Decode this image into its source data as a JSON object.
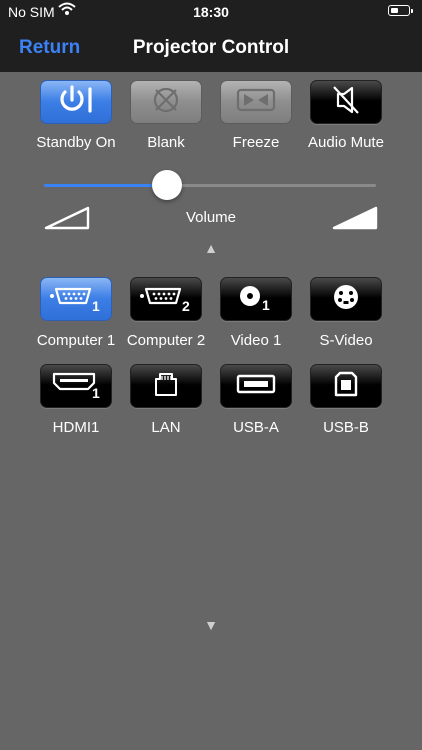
{
  "status": {
    "carrier": "No SIM",
    "time": "18:30"
  },
  "nav": {
    "back_label": "Return",
    "title": "Projector Control"
  },
  "controls": [
    {
      "label": "Standby On",
      "icon": "power-icon",
      "state": "active"
    },
    {
      "label": "Blank",
      "icon": "blank-icon",
      "state": "disabled"
    },
    {
      "label": "Freeze",
      "icon": "freeze-icon",
      "state": "disabled"
    },
    {
      "label": "Audio Mute",
      "icon": "audio-mute-icon",
      "state": "normal"
    }
  ],
  "volume": {
    "label": "Volume",
    "level": 0.37
  },
  "sources": [
    {
      "label": "Computer 1",
      "icon": "vga-1-icon",
      "state": "active"
    },
    {
      "label": "Computer 2",
      "icon": "vga-2-icon",
      "state": "normal"
    },
    {
      "label": "Video 1",
      "icon": "video-1-icon",
      "state": "normal"
    },
    {
      "label": "S-Video",
      "icon": "svideo-icon",
      "state": "normal"
    },
    {
      "label": "HDMI1",
      "icon": "hdmi-icon",
      "state": "normal"
    },
    {
      "label": "LAN",
      "icon": "lan-icon",
      "state": "normal"
    },
    {
      "label": "USB-A",
      "icon": "usb-a-icon",
      "state": "normal"
    },
    {
      "label": "USB-B",
      "icon": "usb-b-icon",
      "state": "normal"
    }
  ],
  "colors": {
    "accent": "#3b82f6",
    "background": "#666666",
    "navbar": "#1f1f1f"
  }
}
